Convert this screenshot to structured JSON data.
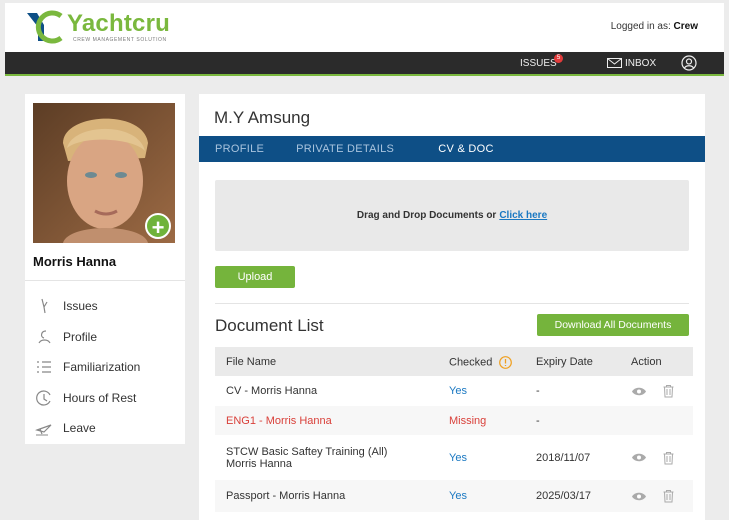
{
  "brand": {
    "name": "Yachtcru",
    "tagline": "CREW MANAGEMENT SOLUTION",
    "accent": "#7ab83e",
    "navy": "#0e4f86"
  },
  "header": {
    "logged_prefix": "Logged in as:",
    "logged_user": "Crew"
  },
  "nav": {
    "issues_label": "ISSUES",
    "issues_count": "5",
    "inbox_label": "INBOX"
  },
  "sidebar": {
    "user_name": "Morris Hanna",
    "items": [
      {
        "label": "Issues",
        "icon": "pen-icon"
      },
      {
        "label": "Profile",
        "icon": "profile-icon"
      },
      {
        "label": "Familiarization",
        "icon": "list-icon"
      },
      {
        "label": "Hours of Rest",
        "icon": "clock-icon"
      },
      {
        "label": "Leave",
        "icon": "plane-icon"
      }
    ]
  },
  "main": {
    "vessel_name": "M.Y Amsung",
    "tabs": [
      {
        "label": "PROFILE"
      },
      {
        "label": "PRIVATE DETAILS"
      },
      {
        "label": "CV & DOC"
      }
    ],
    "dropzone_text": "Drag and Drop Documents or",
    "dropzone_link": "Click here",
    "upload_label": "Upload",
    "doc_list_title": "Document List",
    "download_all_label": "Download All Documents",
    "table": {
      "headers": {
        "file_name": "File Name",
        "checked": "Checked",
        "expiry": "Expiry Date",
        "action": "Action"
      },
      "rows": [
        {
          "file_line1": "CV -  Morris Hanna",
          "file_line2": "",
          "checked": "Yes",
          "expiry": "-",
          "actions": true
        },
        {
          "file_line1": "ENG1 - Morris Hanna",
          "file_line2": "",
          "checked": "Missing",
          "expiry": "-",
          "actions": false
        },
        {
          "file_line1": "STCW Basic Saftey Training (All)",
          "file_line2": "Morris Hanna",
          "checked": "Yes",
          "expiry": "2018/11/07",
          "actions": true
        },
        {
          "file_line1": "Passport - Morris Hanna",
          "file_line2": "",
          "checked": "Yes",
          "expiry": "2025/03/17",
          "actions": true
        }
      ]
    }
  }
}
